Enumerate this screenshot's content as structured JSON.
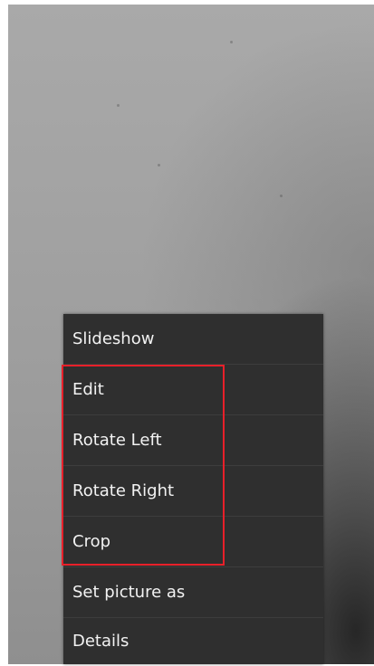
{
  "menu": {
    "items": [
      {
        "label": "Slideshow"
      },
      {
        "label": "Edit"
      },
      {
        "label": "Rotate Left"
      },
      {
        "label": "Rotate Right"
      },
      {
        "label": "Crop"
      },
      {
        "label": "Set picture as"
      },
      {
        "label": "Details"
      }
    ]
  },
  "annotation": {
    "highlight_color": "#e8202a"
  }
}
